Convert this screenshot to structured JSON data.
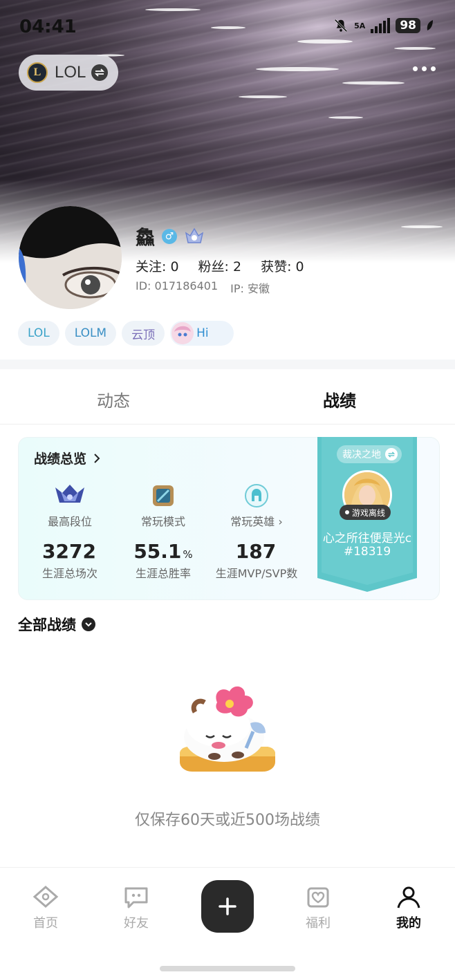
{
  "status_bar": {
    "time": "04:41",
    "network": "5A",
    "battery": "98"
  },
  "header": {
    "game_name": "LOL",
    "lol_logo_letter": "L"
  },
  "profile": {
    "username": "鱻",
    "gender_symbol": "♂",
    "stats": {
      "follow": "关注: 0",
      "fans": "粉丝: 2",
      "likes": "获赞: 0"
    },
    "id_text": "ID: 017186401",
    "ip_text": "IP: 安徽",
    "tags": [
      "LOL",
      "LOLM",
      "云顶",
      "Hi"
    ]
  },
  "tabs": [
    {
      "label": "动态",
      "active": false
    },
    {
      "label": "战绩",
      "active": true
    }
  ],
  "overview": {
    "title": "战绩总览",
    "columns": [
      {
        "label": "最高段位",
        "value": "3272",
        "unit": "",
        "sub": "生涯总场次"
      },
      {
        "label": "常玩模式",
        "value": "55.1",
        "unit": "%",
        "sub": "生涯总胜率"
      },
      {
        "label": "常玩英雄",
        "value": "187",
        "unit": "",
        "sub": "生涯MVP/SVP数"
      }
    ],
    "ribbon": {
      "mode": "裁决之地",
      "status": "游戏离线",
      "player_name": "心之所往便是光c",
      "player_tag": "#18319"
    }
  },
  "records": {
    "filter_label": "全部战绩",
    "empty_text": "仅保存60天或近500场战绩"
  },
  "bottom_nav": {
    "items": [
      {
        "label": "首页",
        "active": false
      },
      {
        "label": "好友",
        "active": false
      },
      {
        "label": "福利",
        "active": false
      },
      {
        "label": "我的",
        "active": true
      }
    ]
  },
  "colors": {
    "accent_teal": "#5ec6c9",
    "tag_blue": "#3ba3c8",
    "dark_button": "#2a2a2a"
  }
}
